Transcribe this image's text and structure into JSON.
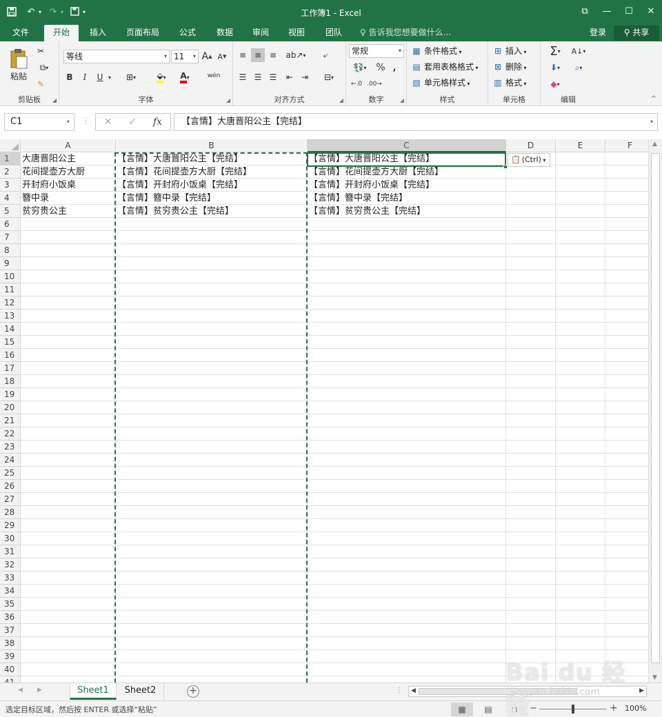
{
  "window": {
    "title": "工作簿1 - Excel",
    "theme_color": "#217346"
  },
  "qat": {
    "save_icon": "save-icon",
    "undo_icon": "undo-icon",
    "redo_icon": "redo-icon",
    "customize_icon": "customize-icon"
  },
  "tabs": [
    {
      "label": "文件"
    },
    {
      "label": "开始",
      "active": true
    },
    {
      "label": "插入"
    },
    {
      "label": "页面布局"
    },
    {
      "label": "公式"
    },
    {
      "label": "数据"
    },
    {
      "label": "审阅"
    },
    {
      "label": "视图"
    },
    {
      "label": "团队"
    }
  ],
  "tell_me": "告诉我您想要做什么...",
  "login": "登录",
  "share": "共享",
  "ribbon": {
    "clipboard": {
      "label": "剪贴板",
      "paste": "粘贴"
    },
    "font": {
      "label": "字体",
      "name": "等线",
      "size": "11",
      "bold": "B",
      "italic": "I",
      "underline": "U",
      "grow": "A",
      "shrink": "A",
      "wen": "wén"
    },
    "alignment": {
      "label": "对齐方式"
    },
    "number": {
      "label": "数字",
      "format": "常规",
      "percent": "%",
      "comma": ","
    },
    "styles": {
      "label": "样式",
      "conditional": "条件格式",
      "table": "套用表格格式",
      "cell": "单元格样式"
    },
    "cells": {
      "label": "单元格",
      "insert": "插入",
      "delete": "删除",
      "format": "格式"
    },
    "editing": {
      "label": "编辑"
    }
  },
  "formula_bar": {
    "name_box": "C1",
    "formula": "【言情】大唐晋阳公主【完结】",
    "fx": "fx"
  },
  "columns": [
    "A",
    "B",
    "C",
    "D",
    "E",
    "F"
  ],
  "selected_column": "C",
  "rows": [
    "1",
    "2",
    "3",
    "4",
    "5",
    "6",
    "7",
    "8",
    "9",
    "10",
    "11",
    "12",
    "13",
    "14",
    "15",
    "16",
    "17",
    "18",
    "19",
    "20",
    "21",
    "22",
    "23",
    "24",
    "25",
    "26",
    "27",
    "28",
    "29",
    "30",
    "31",
    "32",
    "33",
    "34",
    "35",
    "36",
    "37",
    "38",
    "39",
    "40",
    "41"
  ],
  "cells": {
    "A": [
      "大唐晋阳公主",
      "花间提壶方大厨",
      "开封府小饭桌",
      "簪中录",
      "贫穷贵公主"
    ],
    "B": [
      "【言情】大唐晋阳公主【完结】",
      "【言情】花间提壶方大厨【完结】",
      "【言情】开封府小饭桌【完结】",
      "【言情】簪中录【完结】",
      "【言情】贫穷贵公主【完结】"
    ],
    "C": [
      "【言情】大唐晋阳公主【完结】",
      "【言情】花间提壶方大厨【完结】",
      "【言情】开封府小饭桌【完结】",
      "【言情】簪中录【完结】",
      "【言情】贫穷贵公主【完结】"
    ]
  },
  "paste_options": "(Ctrl)",
  "sheets": [
    {
      "label": "Sheet1",
      "active": true
    },
    {
      "label": "Sheet2"
    }
  ],
  "status": {
    "message": "选定目标区域，然后按 ENTER 或选择“粘贴”",
    "zoom": "100%",
    "zoom_level": 1.0
  },
  "watermark": {
    "main": "Bai du 经验",
    "sub": "jingyan.baidu.com"
  }
}
